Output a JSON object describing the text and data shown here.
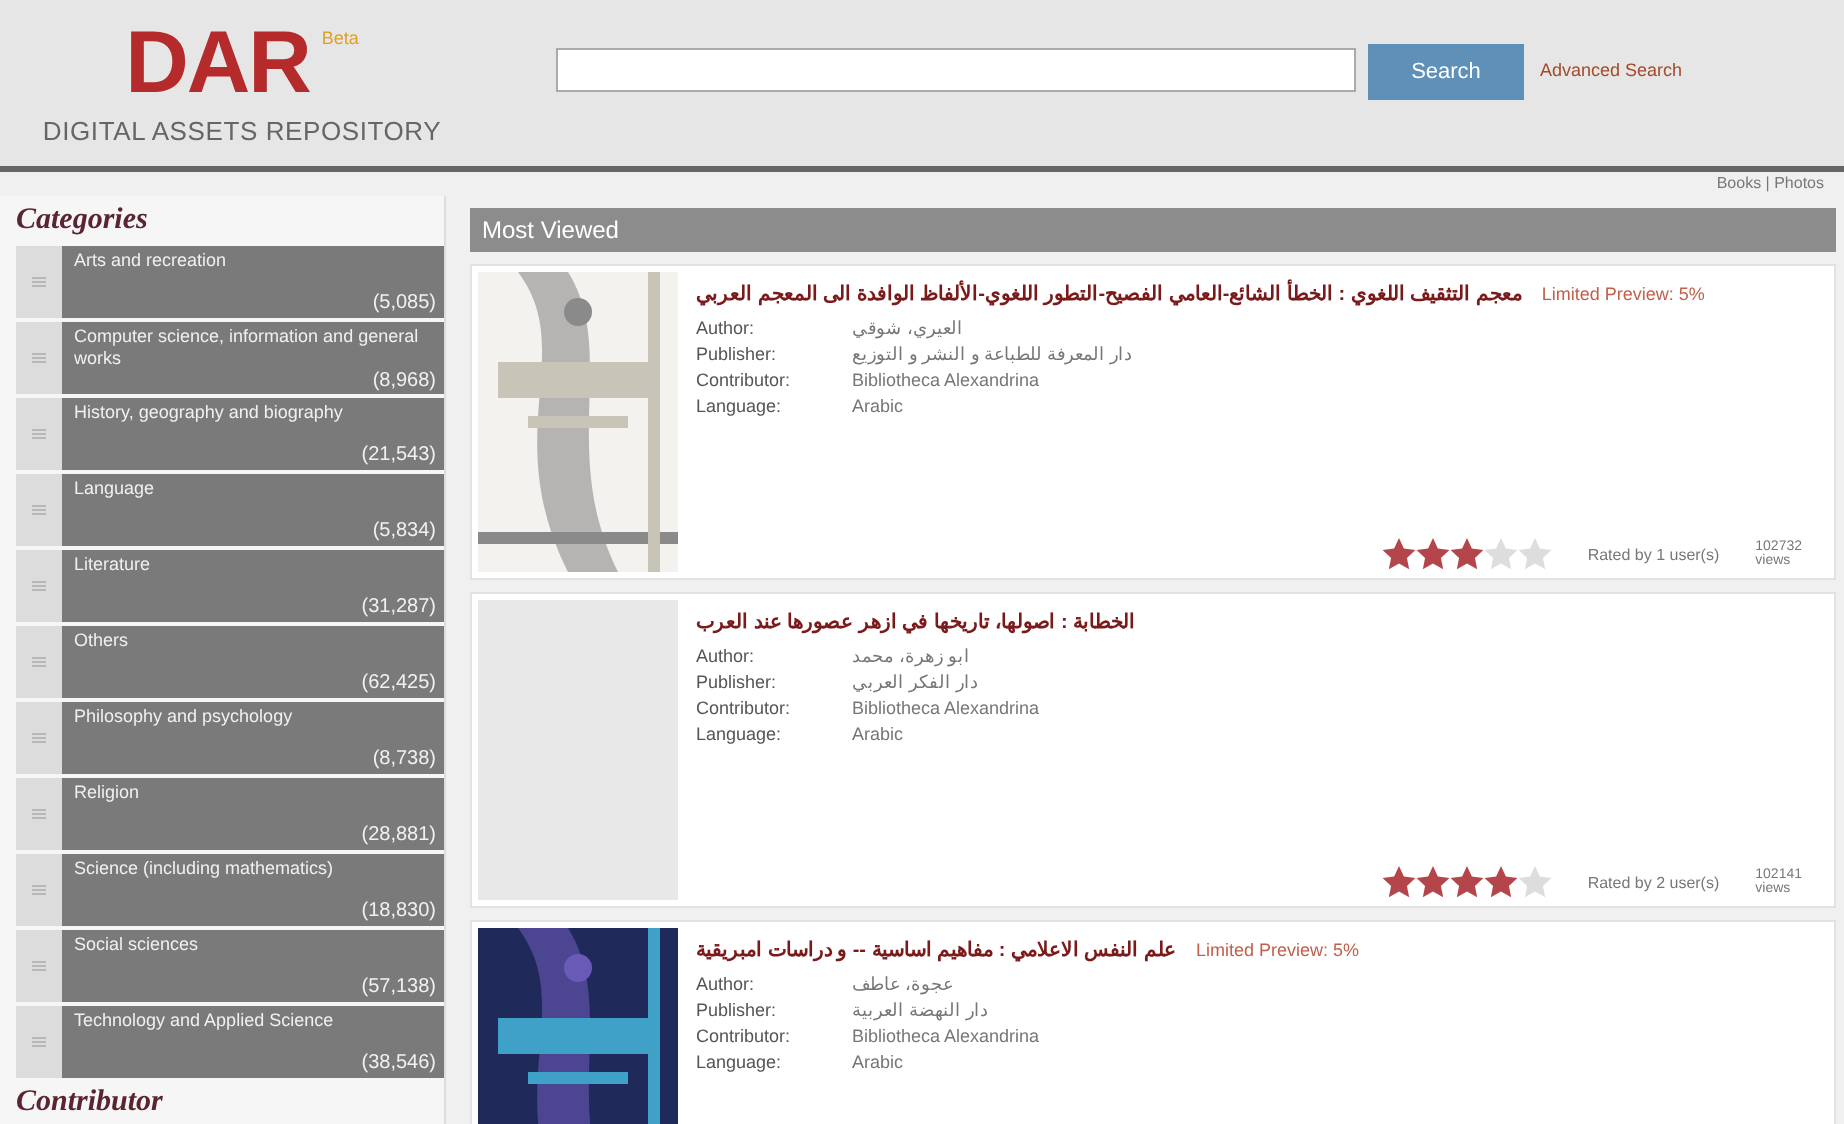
{
  "header": {
    "logo": "DAR",
    "logo_badge": "Beta",
    "logo_subtitle": "DIGITAL ASSETS REPOSITORY",
    "search_button": "Search",
    "advanced_link": "Advanced Search",
    "view_links": "Books | Photos"
  },
  "sidebar": {
    "heading": "Categories",
    "categories": [
      {
        "label": "Arts and recreation",
        "count": "(5,085)"
      },
      {
        "label": "Computer science, information and general works",
        "count": "(8,968)"
      },
      {
        "label": "History, geography and biography",
        "count": "(21,543)"
      },
      {
        "label": "Language",
        "count": "(5,834)"
      },
      {
        "label": "Literature",
        "count": "(31,287)"
      },
      {
        "label": "Others",
        "count": "(62,425)"
      },
      {
        "label": "Philosophy and psychology",
        "count": "(8,738)"
      },
      {
        "label": "Religion",
        "count": "(28,881)"
      },
      {
        "label": "Science (including mathematics)",
        "count": "(18,830)"
      },
      {
        "label": "Social sciences",
        "count": "(57,138)"
      },
      {
        "label": "Technology and Applied Science",
        "count": "(38,546)"
      }
    ],
    "next_heading": "Contributor"
  },
  "main": {
    "heading": "Most Viewed",
    "books": [
      {
        "kind": "picture",
        "title": "معجم التثقيف اللغوي : الخطأ الشائع-العامي الفصيح-التطور اللغوي-الألفاظ الوافدة الى المعجم العربي",
        "preview": "Limited Preview: 5%",
        "fields": [
          {
            "label": "Author:",
            "value": "العيري، شوقي"
          },
          {
            "label": "Publisher:",
            "value": "دار المعرفة للطباعة و النشر و التوزيع"
          },
          {
            "label": "Contributor:",
            "value": "Bibliotheca Alexandrina"
          },
          {
            "label": "Language:",
            "value": "Arabic"
          }
        ],
        "stars": 3,
        "rated": "Rated by 1 user(s)",
        "views": "102732",
        "views_label": "views"
      },
      {
        "title": "الخطابة : اصولها، تاريخها في ازهر عصورها عند العرب",
        "fields": [
          {
            "label": "Author:",
            "value": "ابو زهرة، محمد"
          },
          {
            "label": "Publisher:",
            "value": "دار الفكر العربي"
          },
          {
            "label": "Contributor:",
            "value": "Bibliotheca Alexandrina"
          },
          {
            "label": "Language:",
            "value": "Arabic"
          }
        ],
        "stars": 4,
        "rated": "Rated by 2 user(s)",
        "views": "102141",
        "views_label": "views"
      },
      {
        "kind": "picture",
        "title": "علم النفس الاعلامي : مفاهيم اساسية -- و دراسات امبريقية",
        "preview": "Limited Preview: 5%",
        "fields": [
          {
            "label": "Author:",
            "value": "عجوة، عاطف"
          },
          {
            "label": "Publisher:",
            "value": "دار النهضة العربية"
          },
          {
            "label": "Contributor:",
            "value": "Bibliotheca Alexandrina"
          },
          {
            "label": "Language:",
            "value": "Arabic"
          }
        ]
      }
    ]
  }
}
